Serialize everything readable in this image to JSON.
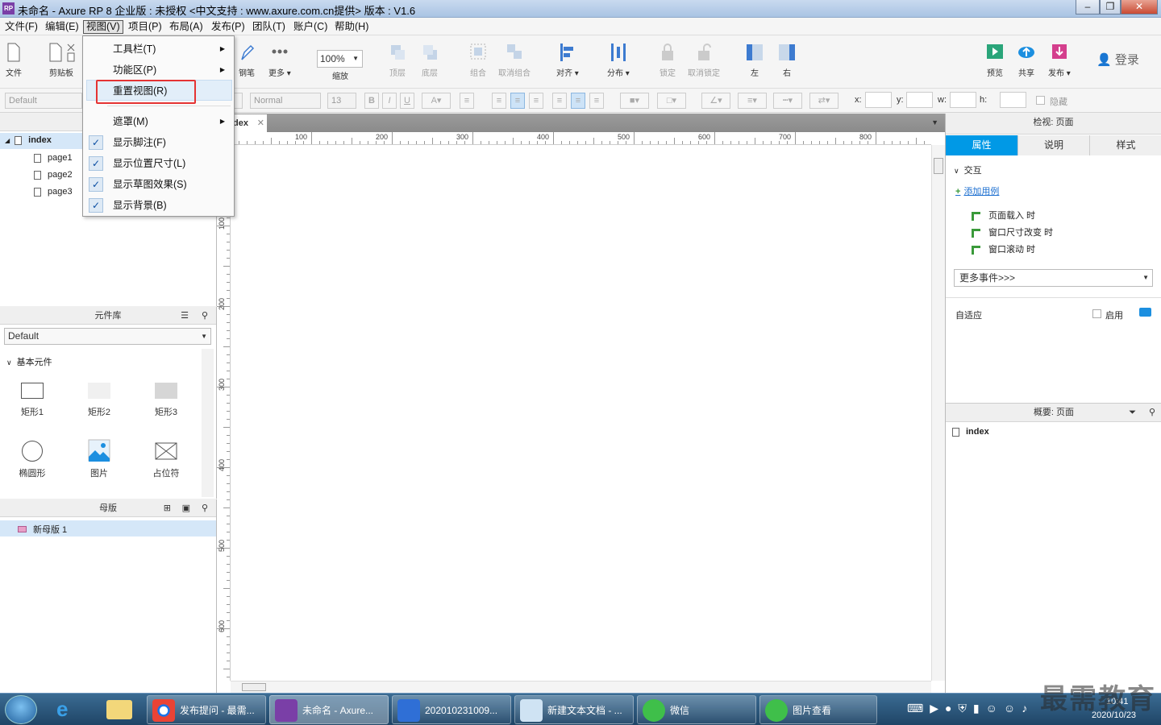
{
  "window": {
    "title": "未命名 - Axure RP 8 企业版 : 未授权      <中文支持 : www.axure.com.cn提供> 版本 : V1.6",
    "logo": "RP",
    "buttons": [
      "minimize-icon",
      "maximize-icon",
      "close-icon"
    ]
  },
  "menubar": [
    "文件(F)",
    "编辑(E)",
    "视图(V)",
    "项目(P)",
    "布局(A)",
    "发布(P)",
    "团队(T)",
    "账户(C)",
    "帮助(H)"
  ],
  "toolbar": {
    "file": "文件",
    "clipboard": "剪贴板",
    "pen": "钢笔",
    "more": "更多 ▾",
    "zoom": "100%",
    "zoom_label": "缩放",
    "top": "顶层",
    "bottom": "底层",
    "group": "组合",
    "ungroup": "取消组合",
    "align": "对齐 ▾",
    "distribute": "分布 ▾",
    "lock": "锁定",
    "unlock": "取消锁定",
    "left": "左",
    "right": "右",
    "preview": "预览",
    "share": "共享",
    "publish": "发布 ▾",
    "login": "登录"
  },
  "formatbar": {
    "style": "Default",
    "font": "Normal",
    "size": "13",
    "x": "x:",
    "y": "y:",
    "w": "w:",
    "h": "h:",
    "hide": "隐藏"
  },
  "view_menu": [
    {
      "label": "工具栏(T)",
      "submenu": true
    },
    {
      "label": "功能区(P)",
      "submenu": true
    },
    {
      "label": "重置视图(R)",
      "highlighted": true
    },
    {
      "label": "遮罩(M)",
      "submenu": true
    },
    {
      "label": "显示脚注(F)",
      "checked": true
    },
    {
      "label": "显示位置尺寸(L)",
      "checked": true
    },
    {
      "label": "显示草图效果(S)",
      "checked": true
    },
    {
      "label": "显示背景(B)",
      "checked": true
    }
  ],
  "pages": {
    "root": "index",
    "children": [
      "page1",
      "page2",
      "page3"
    ]
  },
  "library": {
    "title": "元件库",
    "selected": "Default",
    "section": "基本元件",
    "widgets": [
      "矩形1",
      "矩形2",
      "矩形3",
      "椭圆形",
      "图片",
      "占位符"
    ]
  },
  "masters": {
    "title": "母版",
    "items": [
      "新母版 1"
    ]
  },
  "canvas": {
    "tab": "dex",
    "hruler": [
      "100",
      "200",
      "300",
      "400",
      "500",
      "600",
      "700",
      "800"
    ],
    "vruler": [
      "100",
      "200",
      "300",
      "400",
      "500",
      "600"
    ]
  },
  "inspector": {
    "title": "检视: 页面",
    "tabs": [
      "属性",
      "说明",
      "样式"
    ],
    "section": "交互",
    "add_case": "添加用例",
    "events": [
      "页面载入 时",
      "窗口尺寸改变 时",
      "窗口滚动 时"
    ],
    "more_events": "更多事件>>>",
    "adaptive": "自适应",
    "enable": "启用"
  },
  "outline": {
    "title": "概要: 页面",
    "item": "index"
  },
  "taskbar": {
    "items": [
      "发布提问 - 最需...",
      "未命名 - Axure...",
      "202010231009...",
      "新建文本文档 - ...",
      "微信",
      "图片查看"
    ],
    "time": "10:41",
    "date": "2020/10/23"
  },
  "watermark": "最需教育",
  "colors": {
    "accent": "#0099e6",
    "highlight_box": "#e53333",
    "taskbar": "#2a5478"
  }
}
